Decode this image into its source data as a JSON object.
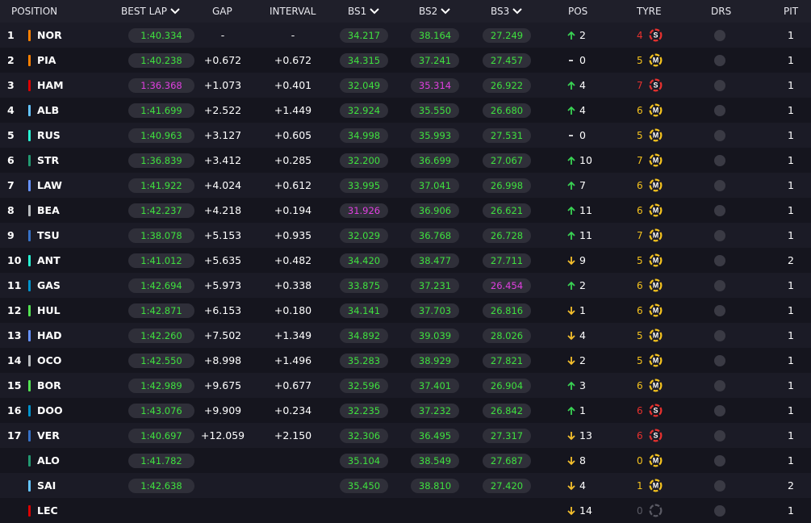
{
  "header": {
    "position": "POSITION",
    "best_lap": "BEST LAP",
    "gap": "GAP",
    "interval": "INTERVAL",
    "bs1": "BS1",
    "bs2": "BS2",
    "bs3": "BS3",
    "pos": "POS",
    "tyre": "TYRE",
    "drs": "DRS",
    "pit": "PIT"
  },
  "colors": {
    "green": "#3fe03f",
    "purple": "#e040e0",
    "up": "#39d353",
    "down": "#f6c02c",
    "soft": "#e8312e",
    "medium": "#f4c21e",
    "none": "#5a5a64"
  },
  "drivers": [
    {
      "pos": "1",
      "code": "NOR",
      "team_color": "#ff8000",
      "best": "1:40.334",
      "best_c": "green",
      "gap": "-",
      "int": "-",
      "bs1": "34.217",
      "bs1_c": "green",
      "bs2": "38.164",
      "bs2_c": "green",
      "bs3": "27.249",
      "bs3_c": "green",
      "dir": "up",
      "dpos": "2",
      "tnum": "4",
      "tyre": "S",
      "pit": "1"
    },
    {
      "pos": "2",
      "code": "PIA",
      "team_color": "#ff8000",
      "best": "1:40.238",
      "best_c": "green",
      "gap": "+0.672",
      "int": "+0.672",
      "bs1": "34.315",
      "bs1_c": "green",
      "bs2": "37.241",
      "bs2_c": "green",
      "bs3": "27.457",
      "bs3_c": "green",
      "dir": "none",
      "dpos": "0",
      "tnum": "5",
      "tyre": "M",
      "pit": "1"
    },
    {
      "pos": "3",
      "code": "HAM",
      "team_color": "#dc0000",
      "best": "1:36.368",
      "best_c": "purple",
      "gap": "+1.073",
      "int": "+0.401",
      "bs1": "32.049",
      "bs1_c": "green",
      "bs2": "35.314",
      "bs2_c": "purple",
      "bs3": "26.922",
      "bs3_c": "green",
      "dir": "up",
      "dpos": "4",
      "tnum": "7",
      "tyre": "S",
      "pit": "1"
    },
    {
      "pos": "4",
      "code": "ALB",
      "team_color": "#64c4ff",
      "best": "1:41.699",
      "best_c": "green",
      "gap": "+2.522",
      "int": "+1.449",
      "bs1": "32.924",
      "bs1_c": "green",
      "bs2": "35.550",
      "bs2_c": "green",
      "bs3": "26.680",
      "bs3_c": "green",
      "dir": "up",
      "dpos": "4",
      "tnum": "6",
      "tyre": "M",
      "pit": "1"
    },
    {
      "pos": "5",
      "code": "RUS",
      "team_color": "#27f4d2",
      "best": "1:40.963",
      "best_c": "green",
      "gap": "+3.127",
      "int": "+0.605",
      "bs1": "34.998",
      "bs1_c": "green",
      "bs2": "35.993",
      "bs2_c": "green",
      "bs3": "27.531",
      "bs3_c": "green",
      "dir": "none",
      "dpos": "0",
      "tnum": "5",
      "tyre": "M",
      "pit": "1"
    },
    {
      "pos": "6",
      "code": "STR",
      "team_color": "#229971",
      "best": "1:36.839",
      "best_c": "green",
      "gap": "+3.412",
      "int": "+0.285",
      "bs1": "32.200",
      "bs1_c": "green",
      "bs2": "36.699",
      "bs2_c": "green",
      "bs3": "27.067",
      "bs3_c": "green",
      "dir": "up",
      "dpos": "10",
      "tnum": "7",
      "tyre": "M",
      "pit": "1"
    },
    {
      "pos": "7",
      "code": "LAW",
      "team_color": "#6692ff",
      "best": "1:41.922",
      "best_c": "green",
      "gap": "+4.024",
      "int": "+0.612",
      "bs1": "33.995",
      "bs1_c": "green",
      "bs2": "37.041",
      "bs2_c": "green",
      "bs3": "26.998",
      "bs3_c": "green",
      "dir": "up",
      "dpos": "7",
      "tnum": "6",
      "tyre": "M",
      "pit": "1"
    },
    {
      "pos": "8",
      "code": "BEA",
      "team_color": "#b6babd",
      "best": "1:42.237",
      "best_c": "green",
      "gap": "+4.218",
      "int": "+0.194",
      "bs1": "31.926",
      "bs1_c": "purple",
      "bs2": "36.906",
      "bs2_c": "green",
      "bs3": "26.621",
      "bs3_c": "green",
      "dir": "up",
      "dpos": "11",
      "tnum": "6",
      "tyre": "M",
      "pit": "1"
    },
    {
      "pos": "9",
      "code": "TSU",
      "team_color": "#3671c6",
      "best": "1:38.078",
      "best_c": "green",
      "gap": "+5.153",
      "int": "+0.935",
      "bs1": "32.029",
      "bs1_c": "green",
      "bs2": "36.768",
      "bs2_c": "green",
      "bs3": "26.728",
      "bs3_c": "green",
      "dir": "up",
      "dpos": "11",
      "tnum": "7",
      "tyre": "M",
      "pit": "1"
    },
    {
      "pos": "10",
      "code": "ANT",
      "team_color": "#27f4d2",
      "best": "1:41.012",
      "best_c": "green",
      "gap": "+5.635",
      "int": "+0.482",
      "bs1": "34.420",
      "bs1_c": "green",
      "bs2": "38.477",
      "bs2_c": "green",
      "bs3": "27.711",
      "bs3_c": "green",
      "dir": "down",
      "dpos": "9",
      "tnum": "5",
      "tyre": "M",
      "pit": "2"
    },
    {
      "pos": "11",
      "code": "GAS",
      "team_color": "#0093cc",
      "best": "1:42.694",
      "best_c": "green",
      "gap": "+5.973",
      "int": "+0.338",
      "bs1": "33.875",
      "bs1_c": "green",
      "bs2": "37.231",
      "bs2_c": "green",
      "bs3": "26.454",
      "bs3_c": "purple",
      "dir": "up",
      "dpos": "2",
      "tnum": "6",
      "tyre": "M",
      "pit": "1"
    },
    {
      "pos": "12",
      "code": "HUL",
      "team_color": "#52e252",
      "best": "1:42.871",
      "best_c": "green",
      "gap": "+6.153",
      "int": "+0.180",
      "bs1": "34.141",
      "bs1_c": "green",
      "bs2": "37.703",
      "bs2_c": "green",
      "bs3": "26.816",
      "bs3_c": "green",
      "dir": "down",
      "dpos": "1",
      "tnum": "6",
      "tyre": "M",
      "pit": "1"
    },
    {
      "pos": "13",
      "code": "HAD",
      "team_color": "#6692ff",
      "best": "1:42.260",
      "best_c": "green",
      "gap": "+7.502",
      "int": "+1.349",
      "bs1": "34.892",
      "bs1_c": "green",
      "bs2": "39.039",
      "bs2_c": "green",
      "bs3": "28.026",
      "bs3_c": "green",
      "dir": "down",
      "dpos": "4",
      "tnum": "5",
      "tyre": "M",
      "pit": "1"
    },
    {
      "pos": "14",
      "code": "OCO",
      "team_color": "#b6babd",
      "best": "1:42.550",
      "best_c": "green",
      "gap": "+8.998",
      "int": "+1.496",
      "bs1": "35.283",
      "bs1_c": "green",
      "bs2": "38.929",
      "bs2_c": "green",
      "bs3": "27.821",
      "bs3_c": "green",
      "dir": "down",
      "dpos": "2",
      "tnum": "5",
      "tyre": "M",
      "pit": "1"
    },
    {
      "pos": "15",
      "code": "BOR",
      "team_color": "#52e252",
      "best": "1:42.989",
      "best_c": "green",
      "gap": "+9.675",
      "int": "+0.677",
      "bs1": "32.596",
      "bs1_c": "green",
      "bs2": "37.401",
      "bs2_c": "green",
      "bs3": "26.904",
      "bs3_c": "green",
      "dir": "up",
      "dpos": "3",
      "tnum": "6",
      "tyre": "M",
      "pit": "1"
    },
    {
      "pos": "16",
      "code": "DOO",
      "team_color": "#0093cc",
      "best": "1:43.076",
      "best_c": "green",
      "gap": "+9.909",
      "int": "+0.234",
      "bs1": "32.235",
      "bs1_c": "green",
      "bs2": "37.232",
      "bs2_c": "green",
      "bs3": "26.842",
      "bs3_c": "green",
      "dir": "up",
      "dpos": "1",
      "tnum": "6",
      "tyre": "S",
      "pit": "1"
    },
    {
      "pos": "17",
      "code": "VER",
      "team_color": "#3671c6",
      "best": "1:40.697",
      "best_c": "green",
      "gap": "+12.059",
      "int": "+2.150",
      "bs1": "32.306",
      "bs1_c": "green",
      "bs2": "36.495",
      "bs2_c": "green",
      "bs3": "27.317",
      "bs3_c": "green",
      "dir": "down",
      "dpos": "13",
      "tnum": "6",
      "tyre": "S",
      "pit": "1"
    },
    {
      "pos": "",
      "code": "ALO",
      "team_color": "#229971",
      "best": "1:41.782",
      "best_c": "green",
      "gap": "",
      "int": "",
      "bs1": "35.104",
      "bs1_c": "green",
      "bs2": "38.549",
      "bs2_c": "green",
      "bs3": "27.687",
      "bs3_c": "green",
      "dir": "down",
      "dpos": "8",
      "tnum": "0",
      "tyre": "M",
      "pit": "1"
    },
    {
      "pos": "",
      "code": "SAI",
      "team_color": "#64c4ff",
      "best": "1:42.638",
      "best_c": "green",
      "gap": "",
      "int": "",
      "bs1": "35.450",
      "bs1_c": "green",
      "bs2": "38.810",
      "bs2_c": "green",
      "bs3": "27.420",
      "bs3_c": "green",
      "dir": "down",
      "dpos": "4",
      "tnum": "1",
      "tyre": "M",
      "pit": "2"
    },
    {
      "pos": "",
      "code": "LEC",
      "team_color": "#dc0000",
      "best": "",
      "best_c": "green",
      "gap": "",
      "int": "",
      "bs1": "",
      "bs1_c": "green",
      "bs2": "",
      "bs2_c": "green",
      "bs3": "",
      "bs3_c": "green",
      "dir": "down",
      "dpos": "14",
      "tnum": "0",
      "tyre": "",
      "pit": "1"
    }
  ]
}
